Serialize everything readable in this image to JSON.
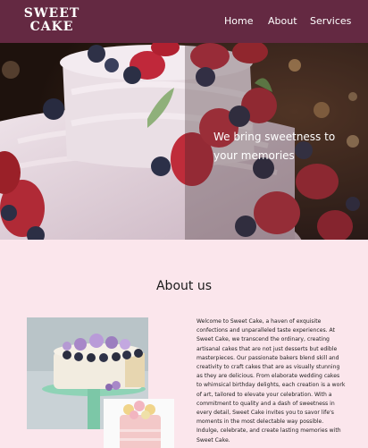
{
  "brand": {
    "logo": "SWEET CAKE"
  },
  "nav": {
    "items": [
      "Home",
      "About",
      "Services"
    ]
  },
  "hero": {
    "tagline": "We bring sweetness to your memories"
  },
  "about": {
    "title": "About us",
    "text": "Welcome to Sweet Cake, a haven of exquisite confections and unparalleled taste experiences. At Sweet Cake, we transcend the ordinary, creating artisanal cakes that are not just desserts but edible masterpieces. Our passionate bakers blend skill and creativity to craft cakes that are as visually stunning as they are delicious. From elaborate wedding cakes to whimsical birthday delights, each creation is a work of art, tailored to elevate your celebration. With a commitment to quality and a dash of sweetness in every detail, Sweet Cake invites you to savor life's moments in the most delectable way possible. Indulge, celebrate, and create lasting memories with Sweet Cake."
  },
  "colors": {
    "header": "#642942",
    "page_bg": "#fbe6ec",
    "text_on_header": "#ffffff"
  }
}
